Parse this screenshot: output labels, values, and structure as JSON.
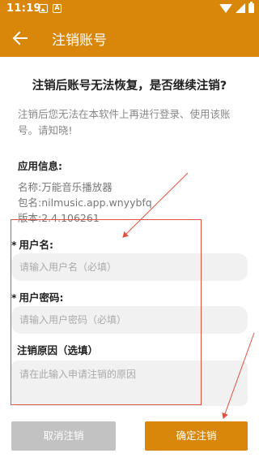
{
  "status": {
    "time": "11:19"
  },
  "appbar": {
    "title": "注销账号"
  },
  "warning": {
    "headline": "注销后账号无法恢复，是否继续注销?",
    "description": "注销后您无法在本软件上再进行登录、使用该账号。请知晓!"
  },
  "app_info": {
    "title": "应用信息:",
    "name_label": "名称:",
    "name_value": "万能音乐播放器",
    "package_label": "包名:",
    "package_value": "nilmusic.app.wnyybfq",
    "version_label": "版本:",
    "version_value": "2.4.106261"
  },
  "form": {
    "required_mark": "*",
    "username_label": "用户名:",
    "username_placeholder": "请输入用户名（必填）",
    "password_label": "用户密码:",
    "password_placeholder": "请输入用户密码（必填）",
    "reason_label": "注销原因（选填）",
    "reason_placeholder": "请在此输入申请注销的原因"
  },
  "buttons": {
    "cancel": "取消注销",
    "confirm": "确定注销"
  },
  "colors": {
    "accent": "#d8870a",
    "annotation": "#e0523f",
    "cancel_bg": "#c2c2c2",
    "input_bg": "#f1f1f1"
  },
  "icons": {
    "back": "arrow-left-icon"
  }
}
